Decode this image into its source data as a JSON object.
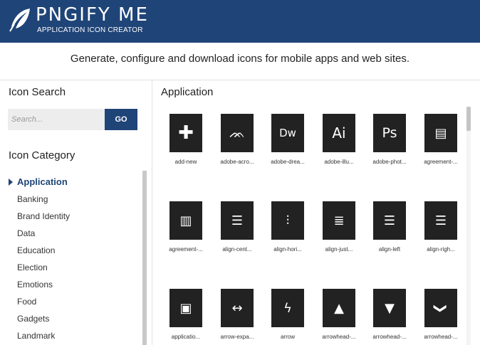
{
  "header": {
    "brand": "PNGIFY ME",
    "subtitle": "APPLICATION ICON CREATOR",
    "logo_icon": "feather-icon",
    "bg_color": "#1f4478"
  },
  "tagline": "Generate, configure and download icons for mobile apps and web sites.",
  "sidebar": {
    "search_title": "Icon Search",
    "search_placeholder": "Search...",
    "go_label": "GO",
    "category_title": "Icon Category",
    "categories": [
      {
        "label": "Application",
        "active": true
      },
      {
        "label": "Banking"
      },
      {
        "label": "Brand Identity"
      },
      {
        "label": "Data"
      },
      {
        "label": "Education"
      },
      {
        "label": "Election"
      },
      {
        "label": "Emotions"
      },
      {
        "label": "Food"
      },
      {
        "label": "Gadgets"
      },
      {
        "label": "Landmark"
      }
    ]
  },
  "main": {
    "title": "Application",
    "icons": [
      {
        "label": "add-new",
        "icon": "plus-icon",
        "glyph": "✚"
      },
      {
        "label": "adobe-acro...",
        "icon": "adobe-acrobat-icon",
        "glyph": "ᨏ"
      },
      {
        "label": "adobe-drea...",
        "icon": "adobe-dreamweaver-icon",
        "glyph": "Dw"
      },
      {
        "label": "adobe-illu...",
        "icon": "adobe-illustrator-icon",
        "glyph": "Ai"
      },
      {
        "label": "adobe-phot...",
        "icon": "adobe-photoshop-icon",
        "glyph": "Ps"
      },
      {
        "label": "agreement-...",
        "icon": "agreement-certificate-icon",
        "glyph": "▤"
      },
      {
        "label": "agreement-...",
        "icon": "agreement-document-icon",
        "glyph": "▥"
      },
      {
        "label": "align-cent...",
        "icon": "align-center-icon",
        "glyph": "☰"
      },
      {
        "label": "align-hori...",
        "icon": "align-horizontal-icon",
        "glyph": "⫶"
      },
      {
        "label": "align-just...",
        "icon": "align-justify-icon",
        "glyph": "≣"
      },
      {
        "label": "align-left",
        "icon": "align-left-icon",
        "glyph": "☰"
      },
      {
        "label": "align-righ...",
        "icon": "align-right-icon",
        "glyph": "☰"
      },
      {
        "label": "applicatio...",
        "icon": "application-window-icon",
        "glyph": "▣"
      },
      {
        "label": "arrow-expa...",
        "icon": "arrow-expand-icon",
        "glyph": "↔"
      },
      {
        "label": "arrow",
        "icon": "arrow-zigzag-icon",
        "glyph": "ϟ"
      },
      {
        "label": "arrowhead-...",
        "icon": "arrowhead-up-icon",
        "glyph": "▲"
      },
      {
        "label": "arrowhead-...",
        "icon": "arrowhead-down-icon",
        "glyph": "▼"
      },
      {
        "label": "arrowhead-...",
        "icon": "chevron-down-icon",
        "glyph": "❯"
      }
    ]
  }
}
